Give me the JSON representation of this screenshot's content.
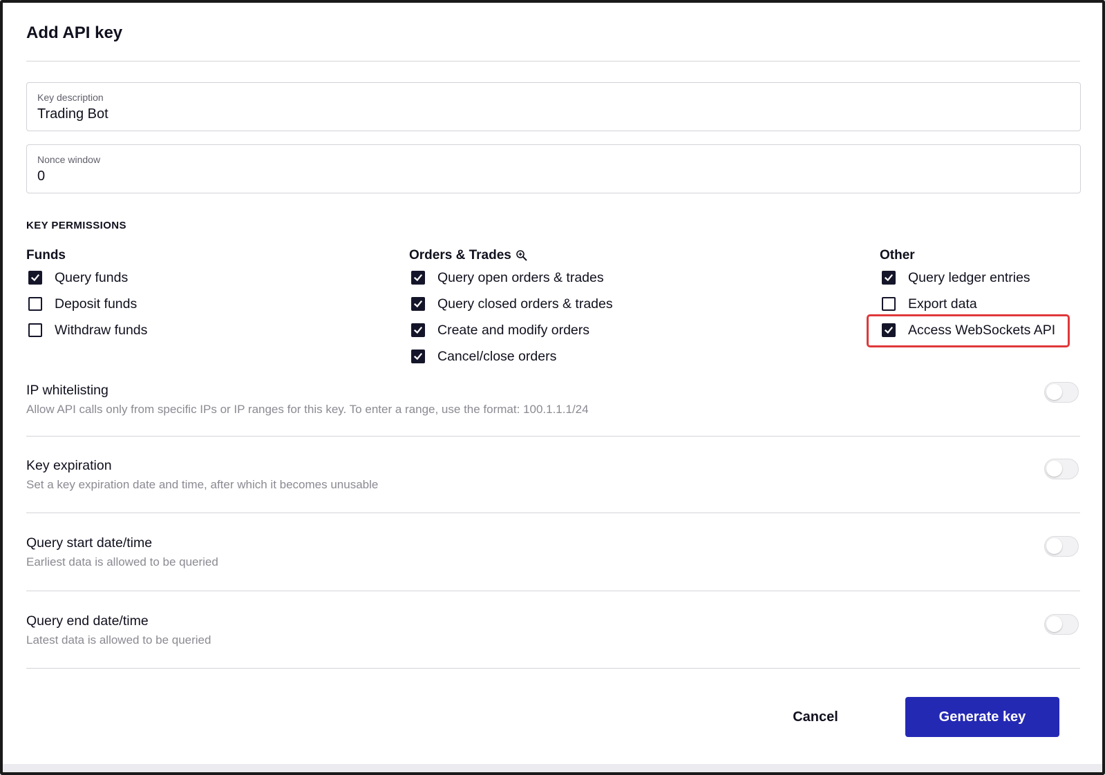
{
  "dialog": {
    "title": "Add API key"
  },
  "fields": {
    "key_description": {
      "label": "Key description",
      "value": "Trading Bot"
    },
    "nonce_window": {
      "label": "Nonce window",
      "value": "0"
    }
  },
  "permissions": {
    "heading": "KEY PERMISSIONS",
    "groups": [
      {
        "title": "Funds",
        "items": [
          {
            "label": "Query funds",
            "checked": true
          },
          {
            "label": "Deposit funds",
            "checked": false
          },
          {
            "label": "Withdraw funds",
            "checked": false
          }
        ]
      },
      {
        "title": "Orders & Trades",
        "items": [
          {
            "label": "Query open orders & trades",
            "checked": true
          },
          {
            "label": "Query closed orders & trades",
            "checked": true
          },
          {
            "label": "Create and modify orders",
            "checked": true
          },
          {
            "label": "Cancel/close orders",
            "checked": true
          }
        ]
      },
      {
        "title": "Other",
        "items": [
          {
            "label": "Query ledger entries",
            "checked": true
          },
          {
            "label": "Export data",
            "checked": false
          },
          {
            "label": "Access WebSockets API",
            "checked": true
          }
        ]
      }
    ]
  },
  "settings": [
    {
      "title": "IP whitelisting",
      "description": "Allow API calls only from specific IPs or IP ranges for this key. To enter a range, use the format: 100.1.1.1/24",
      "enabled": false
    },
    {
      "title": "Key expiration",
      "description": "Set a key expiration date and time, after which it becomes unusable",
      "enabled": false
    },
    {
      "title": "Query start date/time",
      "description": "Earliest data is allowed to be queried",
      "enabled": false
    },
    {
      "title": "Query end date/time",
      "description": "Latest data is allowed to be queried",
      "enabled": false
    }
  ],
  "actions": {
    "cancel_label": "Cancel",
    "generate_label": "Generate key"
  },
  "colors": {
    "primary": "#2429b4",
    "highlight": "#e0373a",
    "checkbox": "#15152a"
  },
  "icons": {
    "orders_heading_icon": "zoom-in-icon",
    "checkbox_checked": "check-icon"
  }
}
